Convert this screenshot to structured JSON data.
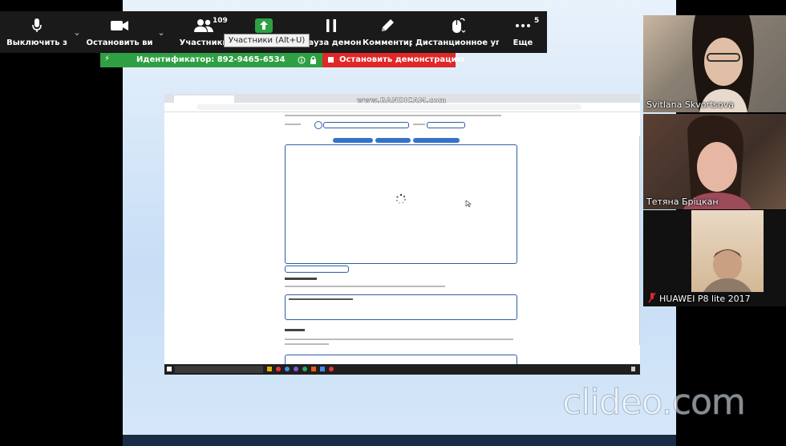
{
  "toolbar": {
    "mute_label": "Выключить з",
    "stop_video_label": "Остановить ви",
    "participants_label": "Участники",
    "participants_count": "109",
    "pause_share_label": "Пауза демонс",
    "annotate_label": "Комментир",
    "remote_control_label": "Дистанционное уп",
    "more_label": "Еще",
    "more_count": "5",
    "tooltip": "Участники (Alt+U)"
  },
  "meeting_bar": {
    "meeting_id": "Идентификатор: 892-9465-6534",
    "stop_share_label": "Остановить демонстрацию"
  },
  "inner_screen": {
    "recorder_watermark": "www.BANDICAM.com"
  },
  "participants": [
    {
      "name": "Svitlana Skvortsova"
    },
    {
      "name": "Тетяна Бріцкан"
    },
    {
      "name": "HUAWEI P8 lite 2017"
    }
  ],
  "watermark": "clideo.com",
  "colors": {
    "meeting_bar": "#2ea043",
    "stop_share": "#e02828",
    "toolbar": "#1a1a1a",
    "share_icon": "#2ea043"
  },
  "icons": {
    "mute": "microphone-icon",
    "stop_video": "video-camera-icon",
    "participants": "participants-icon",
    "share": "share-screen-icon",
    "pause": "pause-icon",
    "annotate": "pencil-icon",
    "remote": "mouse-icon",
    "more": "ellipsis-icon"
  }
}
